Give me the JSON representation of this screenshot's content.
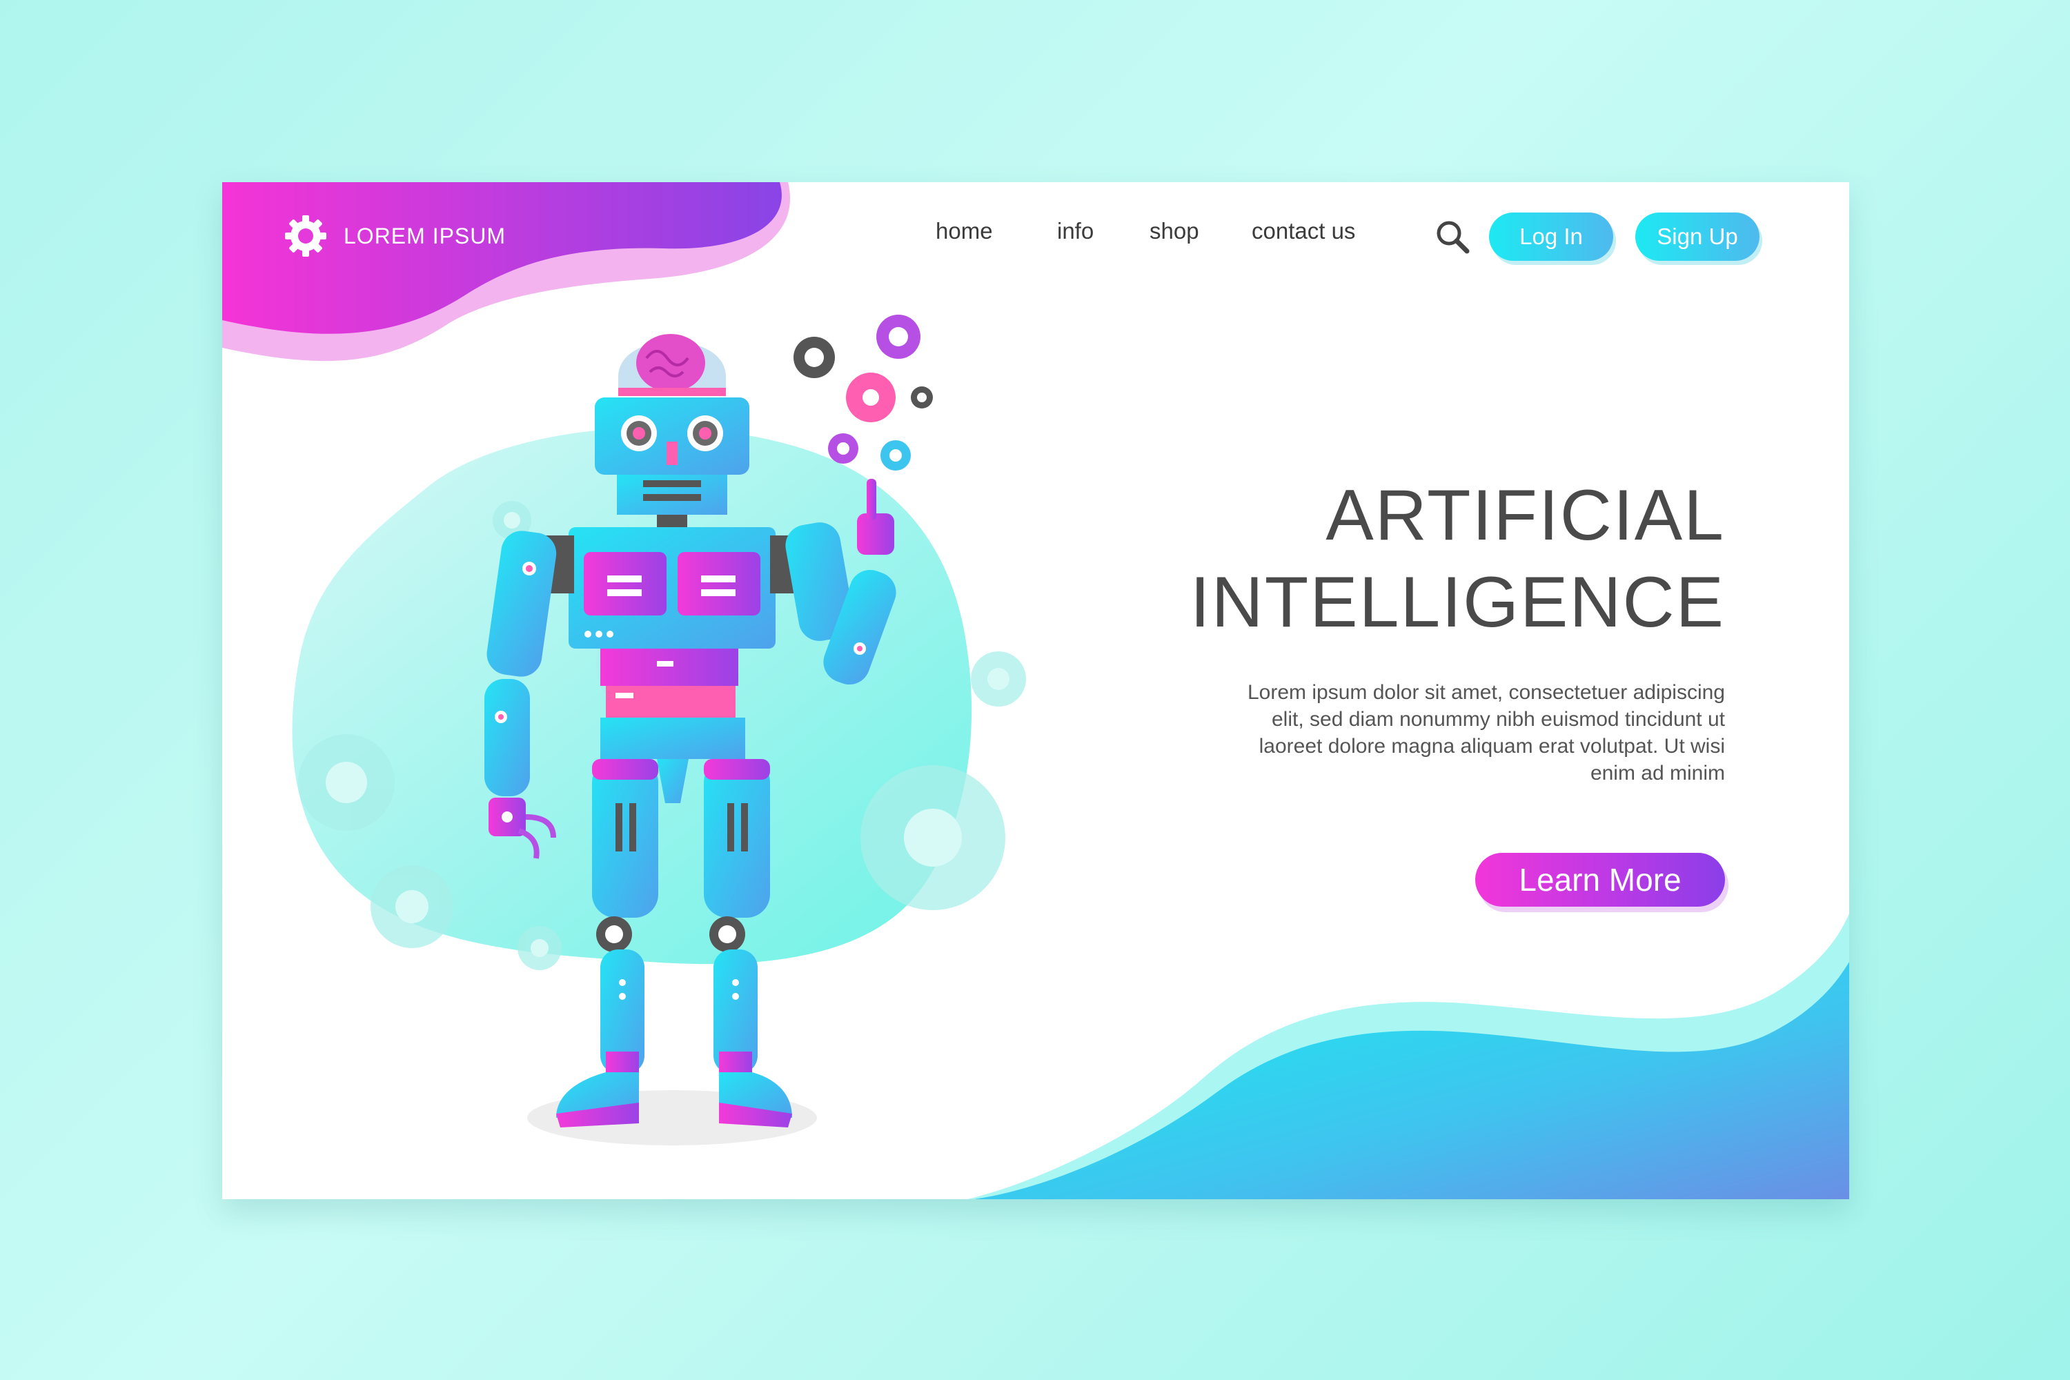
{
  "brand": {
    "name": "LOREM IPSUM",
    "icon": "gear-icon"
  },
  "nav": {
    "links": [
      {
        "label": "home"
      },
      {
        "label": "info"
      },
      {
        "label": "shop"
      },
      {
        "label": "contact us"
      }
    ],
    "search_icon": "search-icon"
  },
  "auth": {
    "login_label": "Log In",
    "signup_label": "Sign Up"
  },
  "hero": {
    "title_line1": "ARTIFICIAL",
    "title_line2": "INTELLIGENCE",
    "description": "Lorem ipsum dolor sit amet, consectetuer adipiscing elit, sed diam nonummy nibh euismod tincidunt ut laoreet dolore magna aliquam erat volutpat. Ut wisi enim ad minim",
    "cta_label": "Learn More"
  },
  "colors": {
    "magenta": "#f236d9",
    "purple": "#8b3ee8",
    "cyan": "#1de9f2",
    "blue": "#4fb9ee",
    "text_dark": "#4a4a4a"
  },
  "illustration": {
    "subject": "robot-illustration",
    "brain": "brain-icon",
    "gears": "gear-icon"
  }
}
